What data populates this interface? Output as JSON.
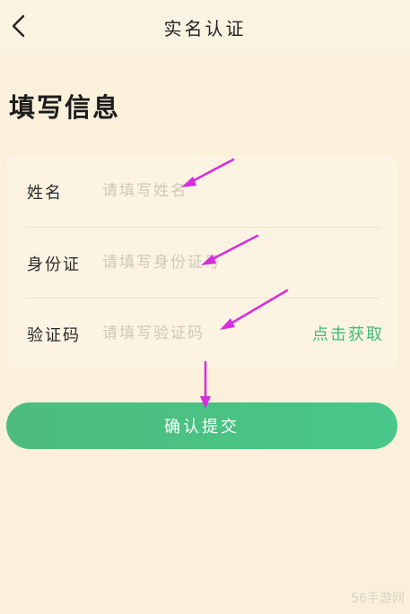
{
  "header": {
    "back_icon": "chevron-left-icon",
    "title": "实名认证"
  },
  "section_title": "填写信息",
  "form": {
    "name": {
      "label": "姓名",
      "placeholder": "请填写姓名",
      "value": ""
    },
    "id_card": {
      "label": "身份证",
      "placeholder": "请填写身份证号",
      "value": ""
    },
    "code": {
      "label": "验证码",
      "placeholder": "请填写验证码",
      "value": "",
      "get_code_label": "点击获取"
    }
  },
  "submit_label": "确认提交",
  "watermark": "56手游网",
  "colors": {
    "background": "#fbf1db",
    "accent": "#3fbb76",
    "annotation_arrow": "#d62ee0"
  }
}
